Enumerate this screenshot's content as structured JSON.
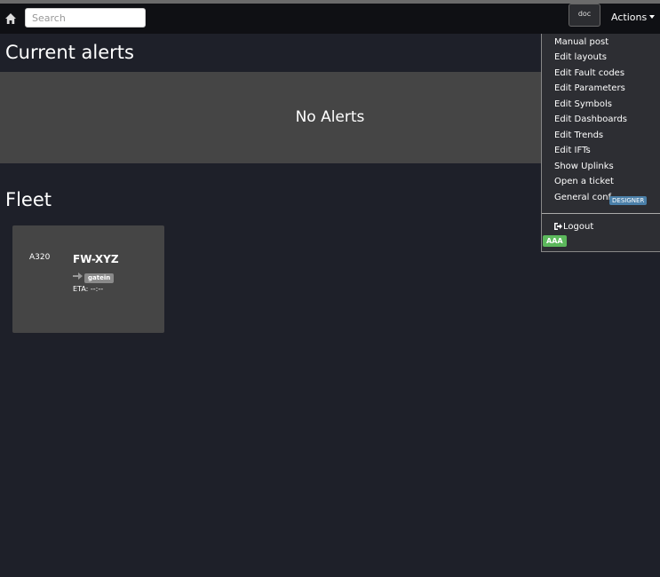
{
  "navbar": {
    "search_placeholder": "Search",
    "doc_label": "doc",
    "actions_label": "Actions"
  },
  "alerts": {
    "title": "Current alerts",
    "empty_text": "No Alerts"
  },
  "fleet": {
    "title": "Fleet",
    "aircraft": [
      {
        "type": "A320",
        "registration": "FW-XYZ",
        "status": "gatein",
        "eta": "ETA: --:--"
      }
    ]
  },
  "menu": {
    "items": [
      {
        "label": "Manual post"
      },
      {
        "label": "Edit layouts"
      },
      {
        "label": "Edit Fault codes"
      },
      {
        "label": "Edit Parameters"
      },
      {
        "label": "Edit Symbols"
      },
      {
        "label": "Edit Dashboards"
      },
      {
        "label": "Edit Trends"
      },
      {
        "label": "Edit IFTs"
      },
      {
        "label": "Show Uplinks"
      },
      {
        "label": "Open a ticket"
      },
      {
        "label": "General conf"
      }
    ],
    "designer_badge": "DESIGNER",
    "logout_label": "Logout",
    "user_badge": "AAA"
  },
  "colors": {
    "background": "#1e2029",
    "navbar": "#0f1014",
    "panel": "#454545",
    "menu": "#2d2e33",
    "designer_badge": "#4a7fa8",
    "user_badge": "#5cb85c"
  }
}
